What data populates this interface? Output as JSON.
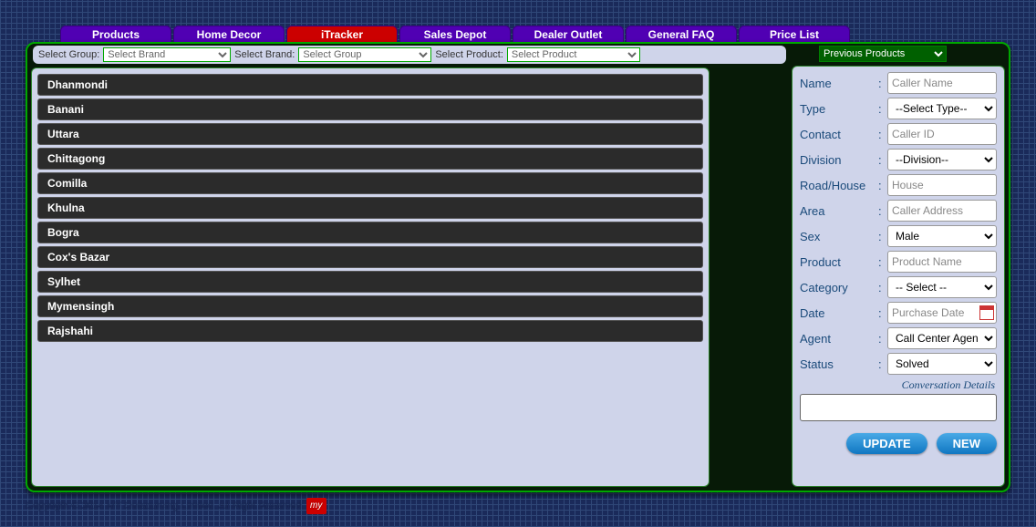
{
  "tabs": [
    {
      "label": "Products"
    },
    {
      "label": "Home Decor"
    },
    {
      "label": "iTracker"
    },
    {
      "label": "Sales Depot"
    },
    {
      "label": "Dealer Outlet"
    },
    {
      "label": "General FAQ"
    },
    {
      "label": "Price List"
    }
  ],
  "active_tab": "iTracker",
  "filters": {
    "group_label": "Select Group:",
    "brand_label": "Select Brand:",
    "product_label": "Select Product:",
    "group_value": "Select Brand",
    "brand_value": "Select Group",
    "product_value": "Select Product"
  },
  "prev_products": {
    "value": "Previous Products"
  },
  "locations": [
    "Dhanmondi",
    "Banani",
    "Uttara",
    "Chittagong",
    "Comilla",
    "Khulna",
    "Bogra",
    "Cox's Bazar",
    "Sylhet",
    "Mymensingh",
    "Rajshahi"
  ],
  "form": {
    "name": {
      "label": "Name",
      "placeholder": "Caller Name"
    },
    "type": {
      "label": "Type",
      "value": "--Select Type--"
    },
    "contact": {
      "label": "Contact",
      "placeholder": "Caller ID"
    },
    "division": {
      "label": "Division",
      "value": "--Division--"
    },
    "road": {
      "label": "Road/House",
      "placeholder": "House"
    },
    "area": {
      "label": "Area",
      "placeholder": "Caller Address"
    },
    "sex": {
      "label": "Sex",
      "value": "Male"
    },
    "product": {
      "label": "Product",
      "placeholder": "Product Name"
    },
    "category": {
      "label": "Category",
      "value": "-- Select --"
    },
    "date": {
      "label": "Date",
      "placeholder": "Purchase Date"
    },
    "agent": {
      "label": "Agent",
      "value": "Call Center Agent"
    },
    "status": {
      "label": "Status",
      "value": "Solved"
    },
    "conversation_label": "Conversation Details"
  },
  "buttons": {
    "update": "UPDATE",
    "new": "NEW"
  },
  "footer": {
    "text": "Copyright © 2014 MY Outsourcing Limited. All Right Reserved",
    "logo": "my"
  }
}
